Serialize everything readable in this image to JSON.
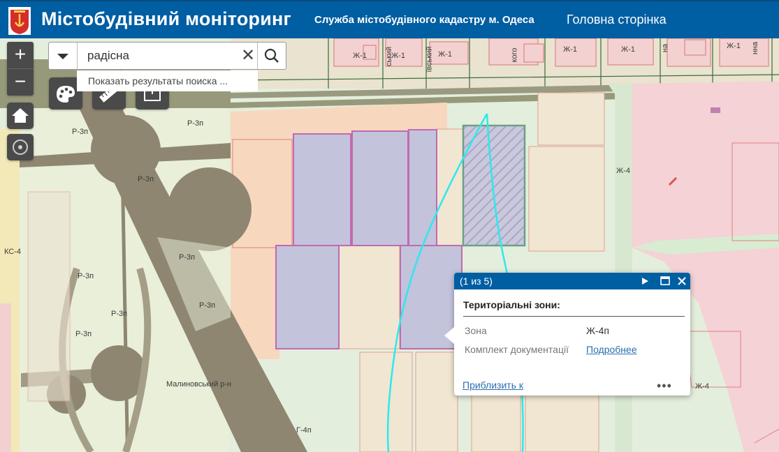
{
  "header": {
    "title": "Містобудівний моніторинг",
    "service_link": "Служба містобудівного кадастру м. Одеса",
    "home_link": "Головна сторінка",
    "brand_color": "#005ea2"
  },
  "controls": {
    "zoom_in": "+",
    "zoom_out": "−"
  },
  "search": {
    "value": "радісна",
    "clear": "✕",
    "suggestion": "Показать результаты поиска ..."
  },
  "map_labels": {
    "street_1": "ський",
    "street_2": "ївський",
    "street_3": "кого",
    "street_4": "на",
    "street_5": "нна",
    "zh1_a": "Ж-1",
    "zh1_b": "Ж-1",
    "zh1_c": "Ж-1",
    "zh1_d": "Ж-1",
    "zh1_e": "Ж-1",
    "zh1_f": "Ж-1",
    "r3p_1": "Р-3п",
    "r3p_2": "Р-3п",
    "r3p_3": "Р-3п",
    "r3p_4": "Р-3п",
    "r3p_5": "Р-3п",
    "r3p_6": "Р-3п",
    "r3p_7": "Р-3п",
    "r3p_8": "Р-3п",
    "ks4": "КС-4",
    "zh4_a": "Ж-4",
    "zh4_b": "Ж-4",
    "district": "Малиновський р-н",
    "g4p": "Г-4п"
  },
  "popup": {
    "pager": "(1 из 5)",
    "title": "Територіальні зони:",
    "zone_label": "Зона",
    "zone_value": "Ж-4п",
    "docs_label": "Комплект документації",
    "docs_link": "Подробнее",
    "zoom_link": "Приблизить к",
    "more": "•••"
  }
}
